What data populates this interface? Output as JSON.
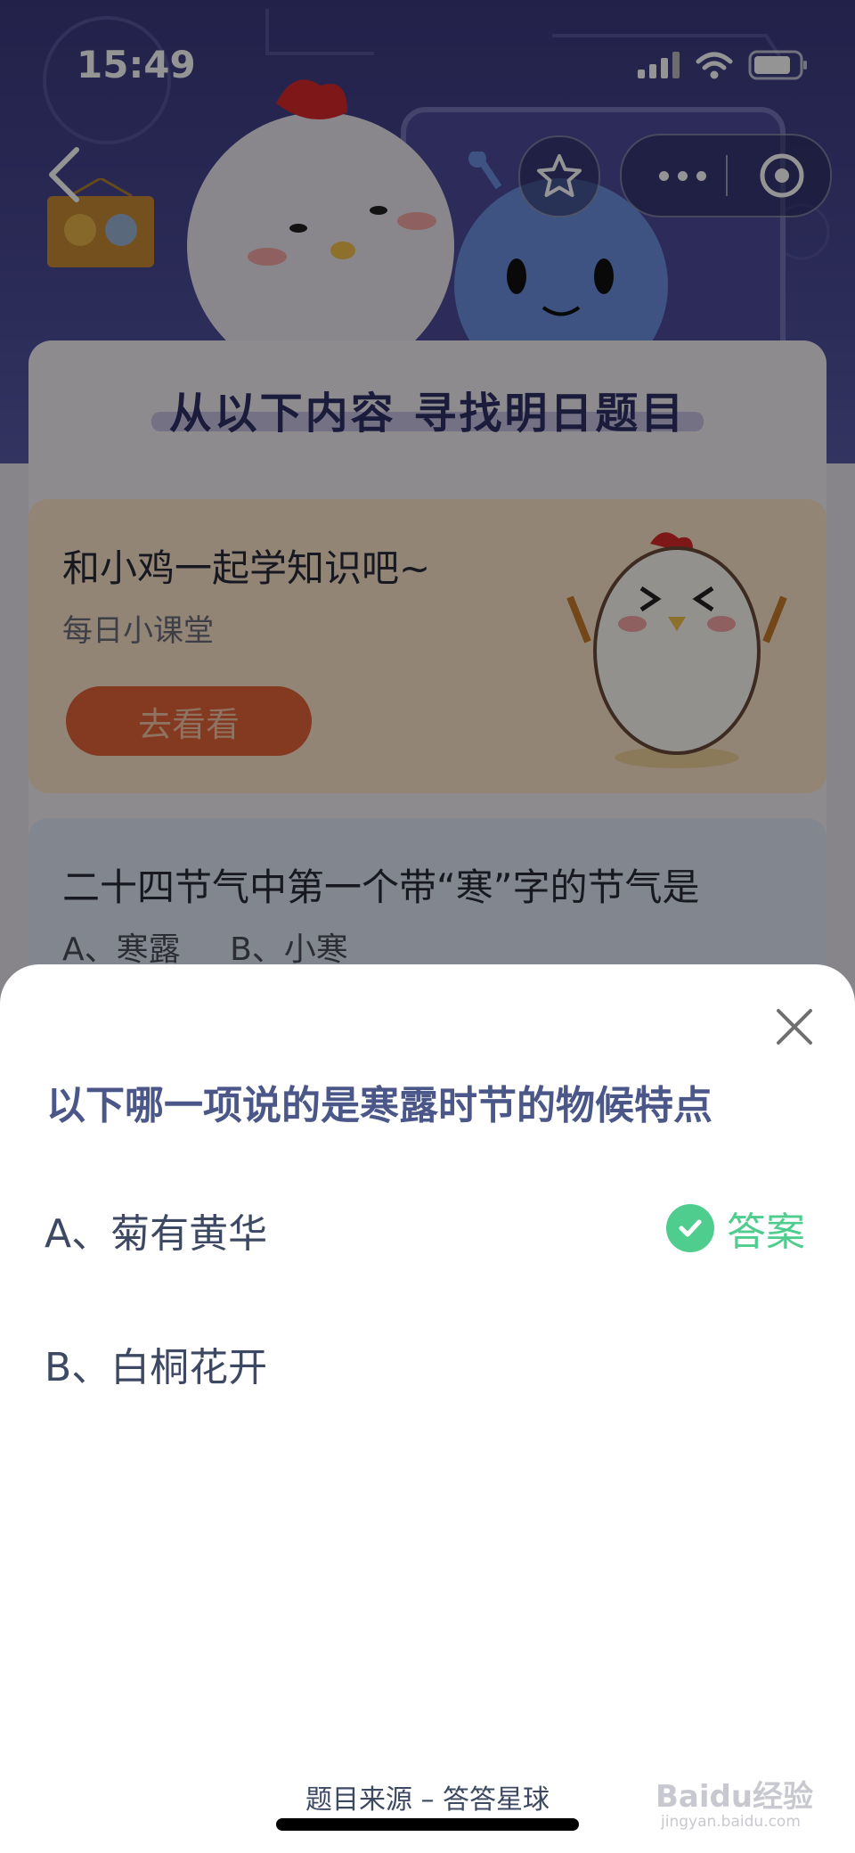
{
  "status_bar": {
    "time": "15:49"
  },
  "header": {
    "back_icon": "chevron-left-icon",
    "star_icon": "star-outline-icon",
    "more_icon": "more-dots-icon",
    "close_icon": "target-circle-icon"
  },
  "main": {
    "card_title": "从以下内容  寻找明日题目",
    "lesson": {
      "title": "和小鸡一起学知识吧~",
      "subtitle": "每日小课堂",
      "button_label": "去看看"
    },
    "question": {
      "title": "二十四节气中第一个带“寒”字的节气是",
      "options": [
        "A、寒露",
        "B、小寒"
      ]
    }
  },
  "sheet": {
    "title": "以下哪一项说的是寒露时节的物候特点",
    "options": [
      {
        "label": "A、菊有黄华",
        "is_answer": true
      },
      {
        "label": "B、白桐花开",
        "is_answer": false
      }
    ],
    "answer_label": "答案",
    "close_icon": "close-x-icon",
    "source": "题目来源 – 答答星球"
  },
  "watermark": {
    "text": "Baidu经验",
    "url_text": "jingyan.baidu.com"
  },
  "colors": {
    "accent_green": "#4fcd8e",
    "sheet_title": "#4b5689",
    "lesson_button": "#e4623a"
  }
}
